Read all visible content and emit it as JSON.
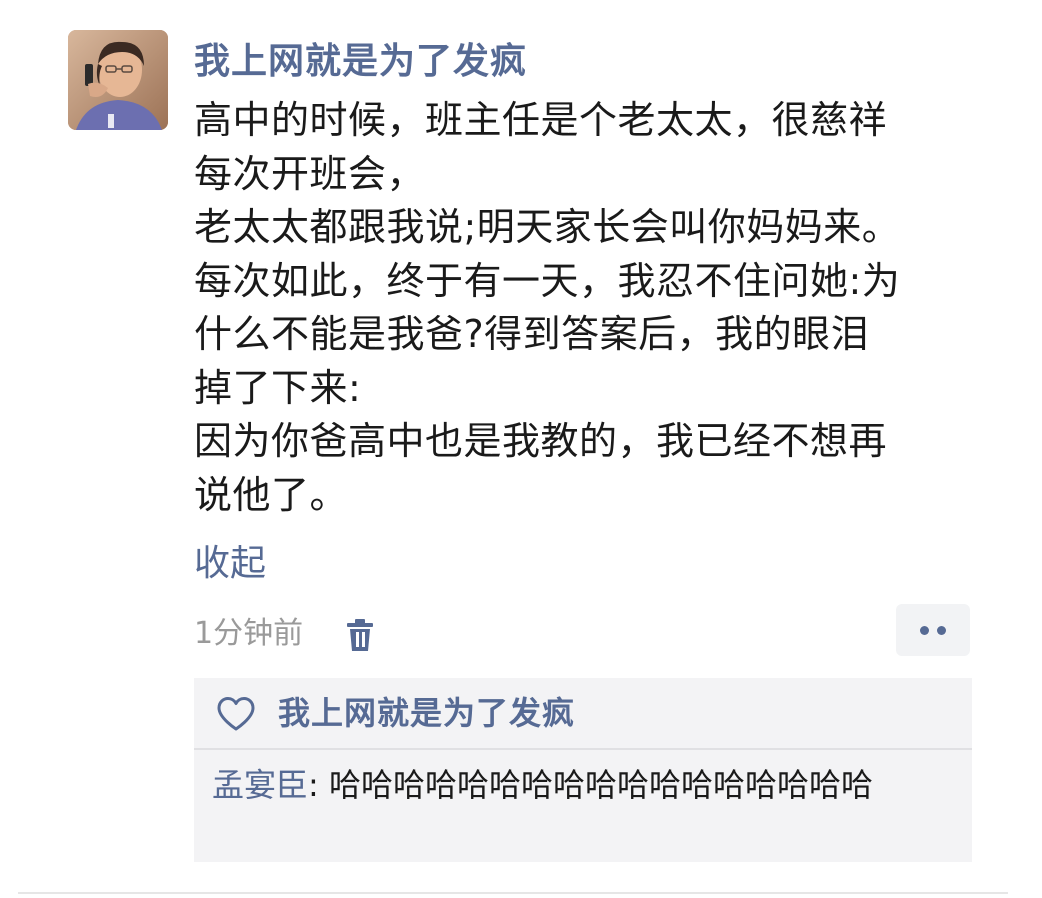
{
  "post": {
    "author": "我上网就是为了发疯",
    "content_lines": [
      "高中的时候，班主任是个老太太，很慈祥",
      "每次开班会，",
      "老太太都跟我说;明天家长会叫你妈妈来。",
      "每次如此，终于有一天，我忍不住问她:为",
      "什么不能是我爸?得到答案后，我的眼泪",
      "掉了下来:",
      "因为你爸高中也是我教的，我已经不想再",
      "说他了。"
    ],
    "collapse_label": "收起",
    "time": "1分钟前"
  },
  "likes": {
    "names": "我上网就是为了发疯"
  },
  "comment": {
    "commenter": "孟宴臣",
    "separator": ": ",
    "text": "哈哈哈哈哈哈哈哈哈哈哈哈哈哈哈哈哈"
  },
  "icons": {
    "delete": "trash-icon",
    "more": "more-dots-icon",
    "like": "heart-outline-icon"
  },
  "colors": {
    "link_blue": "#566a94",
    "time_gray": "#9a9a9a",
    "box_bg": "#f3f3f5"
  }
}
